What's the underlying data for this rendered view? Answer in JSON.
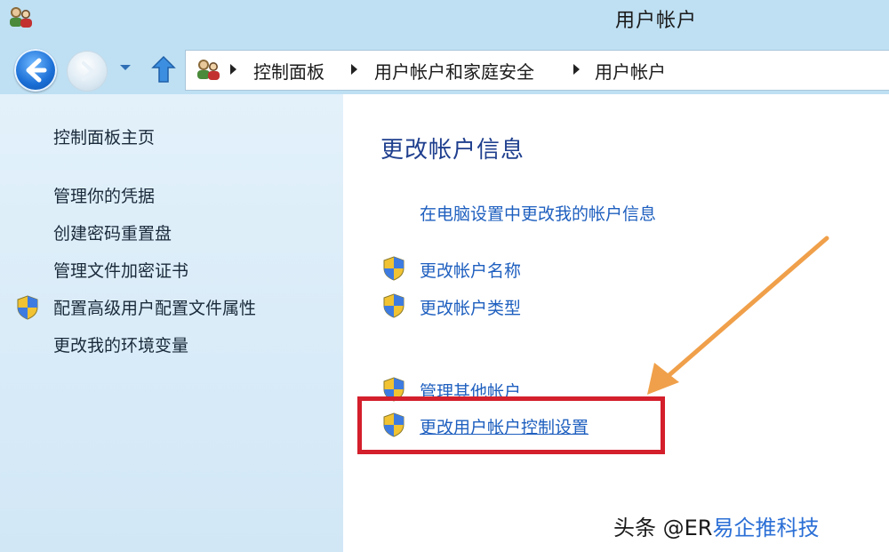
{
  "window": {
    "title": "用户帐户"
  },
  "breadcrumb": {
    "items": [
      "控制面板",
      "用户帐户和家庭安全",
      "用户帐户"
    ]
  },
  "sidebar": {
    "items": [
      {
        "label": "控制面板主页",
        "shield": false
      },
      {
        "label": "管理你的凭据",
        "shield": false
      },
      {
        "label": "创建密码重置盘",
        "shield": false
      },
      {
        "label": "管理文件加密证书",
        "shield": false
      },
      {
        "label": "配置高级用户配置文件属性",
        "shield": true
      },
      {
        "label": "更改我的环境变量",
        "shield": false
      }
    ]
  },
  "main": {
    "heading": "更改帐户信息",
    "links": [
      {
        "label": "在电脑设置中更改我的帐户信息",
        "shield": false
      },
      {
        "label": "更改帐户名称",
        "shield": true
      },
      {
        "label": "更改帐户类型",
        "shield": true
      },
      {
        "label": "管理其他帐户",
        "shield": true
      },
      {
        "label": "更改用户帐户控制设置",
        "shield": true
      }
    ]
  },
  "watermark": {
    "prefix": "头条 @ER",
    "brand": "易企推科技"
  },
  "colors": {
    "titlebar": "#bfe0f3",
    "sidebar": "#dcedf9",
    "link": "#1e5fbf",
    "heading": "#1f3f8e",
    "highlight": "#d41f2c",
    "arrow": "#f0a04a"
  }
}
